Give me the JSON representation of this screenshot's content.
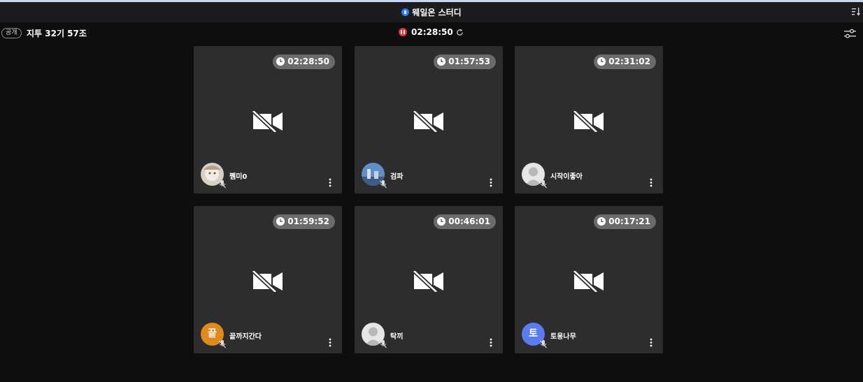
{
  "window": {
    "title": "웨일온 스터디",
    "accent_color": "#2f7cf6"
  },
  "room": {
    "visibility_badge": "공개",
    "name": "지투 32기 57조",
    "timer": "02:28:50",
    "record_color": "#e5332e"
  },
  "tiles": [
    {
      "time": "02:28:50",
      "name": "쩸미0",
      "avatar": "photo-user-icon"
    },
    {
      "time": "01:57:53",
      "name": "검파",
      "avatar": "photo-user-icon"
    },
    {
      "time": "02:31:02",
      "name": "시작이좋아",
      "avatar": "default-user-icon"
    },
    {
      "time": "01:59:52",
      "name": "끝까지간다",
      "avatar": "letter",
      "avatar_letter": "끝",
      "avatar_color": "#e08a1a"
    },
    {
      "time": "00:46:01",
      "name": "탁끼",
      "avatar": "default-user-icon"
    },
    {
      "time": "00:17:21",
      "name": "토용나무",
      "avatar": "letter",
      "avatar_letter": "토",
      "avatar_color": "#5b7cf0"
    }
  ]
}
